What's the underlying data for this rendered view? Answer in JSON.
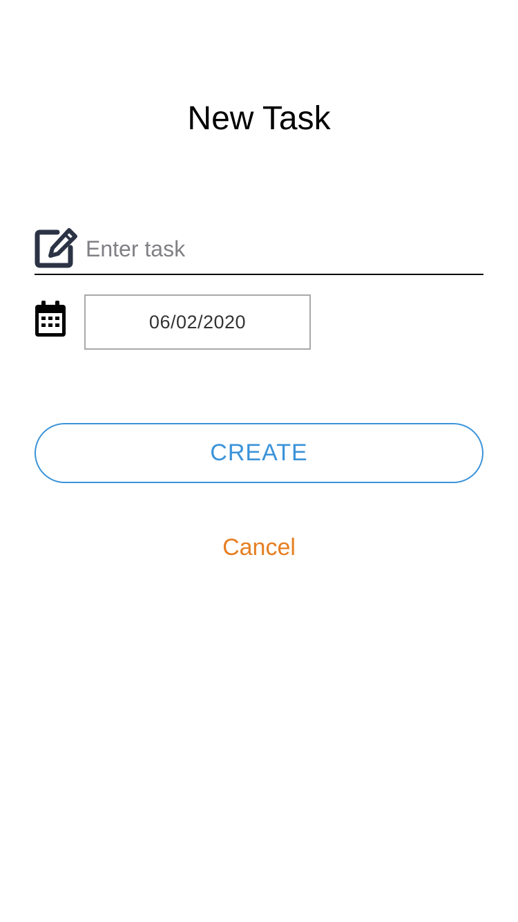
{
  "header": {
    "title": "New Task"
  },
  "form": {
    "task": {
      "icon": "edit-icon",
      "value": "",
      "placeholder": "Enter task"
    },
    "date": {
      "icon": "calendar-icon",
      "value": "06/02/2020"
    }
  },
  "actions": {
    "create_label": "CREATE",
    "cancel_label": "Cancel"
  },
  "colors": {
    "accent": "#3a93d9",
    "cancel": "#e67e22",
    "icon": "#2c3345"
  }
}
